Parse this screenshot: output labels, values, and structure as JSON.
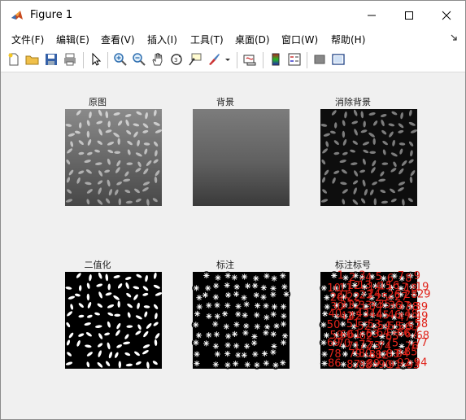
{
  "window": {
    "title": "Figure 1",
    "minimize": "–",
    "maximize": "☐",
    "close": "✕"
  },
  "menu": [
    {
      "label": "文件(F)"
    },
    {
      "label": "编辑(E)"
    },
    {
      "label": "查看(V)"
    },
    {
      "label": "插入(I)"
    },
    {
      "label": "工具(T)"
    },
    {
      "label": "桌面(D)"
    },
    {
      "label": "窗口(W)"
    },
    {
      "label": "帮助(H)"
    }
  ],
  "toolbar": {
    "icons": [
      "new-figure-icon",
      "open-file-icon",
      "save-icon",
      "print-icon",
      "edit-plot-arrow-icon",
      "zoom-in-icon",
      "zoom-out-icon",
      "pan-hand-icon",
      "rotate-3d-icon",
      "data-cursor-icon",
      "brush-icon",
      "brush-dropdown-icon",
      "link-plot-icon",
      "insert-colorbar-icon",
      "insert-legend-icon",
      "hide-plot-tools-icon",
      "show-plot-tools-icon"
    ]
  },
  "axes": [
    {
      "title": "原图"
    },
    {
      "title": "背景"
    },
    {
      "title": "消除背景"
    },
    {
      "title": "二值化"
    },
    {
      "title": "标注"
    },
    {
      "title": "标注标号"
    }
  ],
  "labels_visible": [
    "1",
    "3",
    "4",
    "5",
    "9",
    "14",
    "17",
    "20",
    "27",
    "33",
    "36",
    "39",
    "44",
    "52",
    "58",
    "63",
    "68",
    "71",
    "75",
    "78",
    "82",
    "85",
    "87",
    "89",
    "90",
    "91",
    "93",
    "94",
    "96",
    "97",
    "99",
    "101"
  ],
  "colors": {
    "label_red": "#e0241b",
    "window_bg": "#f0f0f0",
    "marker": "#ffffff"
  }
}
